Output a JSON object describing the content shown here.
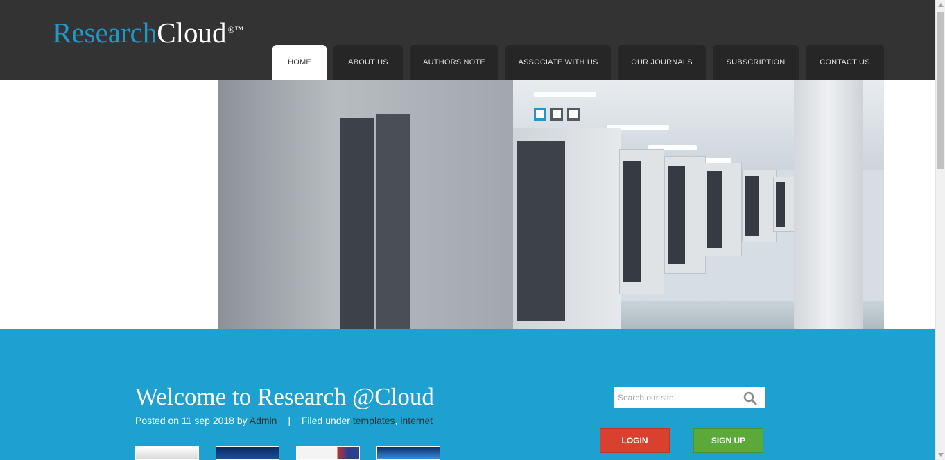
{
  "brand": {
    "name_part1": "Research",
    "name_part2": "Cloud",
    "mark": "®™"
  },
  "nav": {
    "items": [
      {
        "label": "HOME",
        "active": true
      },
      {
        "label": "ABOUT US",
        "active": false
      },
      {
        "label": "AUTHORS NOTE",
        "active": false
      },
      {
        "label": "ASSOCIATE WITH US",
        "active": false
      },
      {
        "label": "OUR JOURNALS",
        "active": false
      },
      {
        "label": "SUBSCRIPTION",
        "active": false
      },
      {
        "label": "CONTACT US",
        "active": false
      }
    ]
  },
  "slider": {
    "total_slides": 3,
    "active_slide": 1
  },
  "post": {
    "title": "Welcome to Research @Cloud",
    "posted_prefix": "Posted on 11 sep 2018 by",
    "author": "Admin",
    "separator": "|",
    "filed_prefix": "Filed under",
    "tags": [
      "templates",
      "internet"
    ],
    "tag_separator": ","
  },
  "search": {
    "placeholder": "Search our site:",
    "value": "",
    "icon": "search-icon"
  },
  "auth": {
    "login_label": "LOGIN",
    "signup_label": "SIGN UP"
  },
  "colors": {
    "header_bg": "#333333",
    "accent": "#1ea0d0",
    "brand_blue": "#2196c9",
    "login": "#d9412e",
    "signup": "#5aa939"
  }
}
